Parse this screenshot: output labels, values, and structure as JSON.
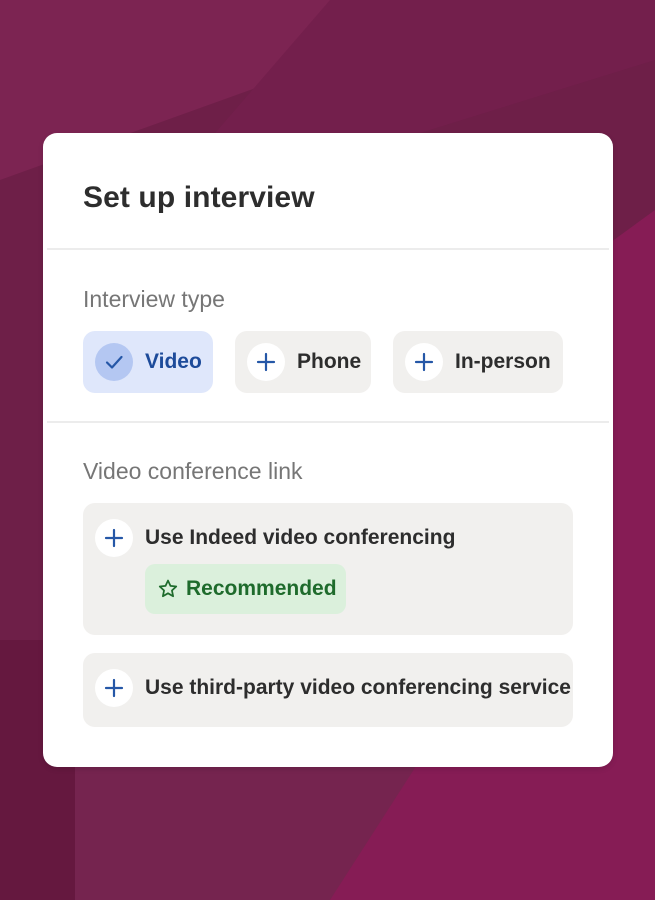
{
  "dialog": {
    "title": "Set up interview"
  },
  "interview_type": {
    "label": "Interview type",
    "options": [
      {
        "label": "Video",
        "selected": true,
        "icon": "check-icon"
      },
      {
        "label": "Phone",
        "selected": false,
        "icon": "plus-icon"
      },
      {
        "label": "In-person",
        "selected": false,
        "icon": "plus-icon"
      }
    ]
  },
  "video_conference": {
    "label": "Video conference link",
    "options": [
      {
        "label": "Use Indeed video conferencing",
        "icon": "plus-icon",
        "badge": {
          "label": "Recommended",
          "icon": "star-icon"
        }
      },
      {
        "label": "Use third-party video conferencing service",
        "icon": "plus-icon"
      }
    ]
  },
  "colors": {
    "background": "#7a2150",
    "card": "#ffffff",
    "selected_chip": "#dfe7fb",
    "selected_text": "#1d4b9a",
    "accent_icon": "#2557a7",
    "badge_bg": "#dbf0dc",
    "badge_text": "#1e6b2c"
  }
}
